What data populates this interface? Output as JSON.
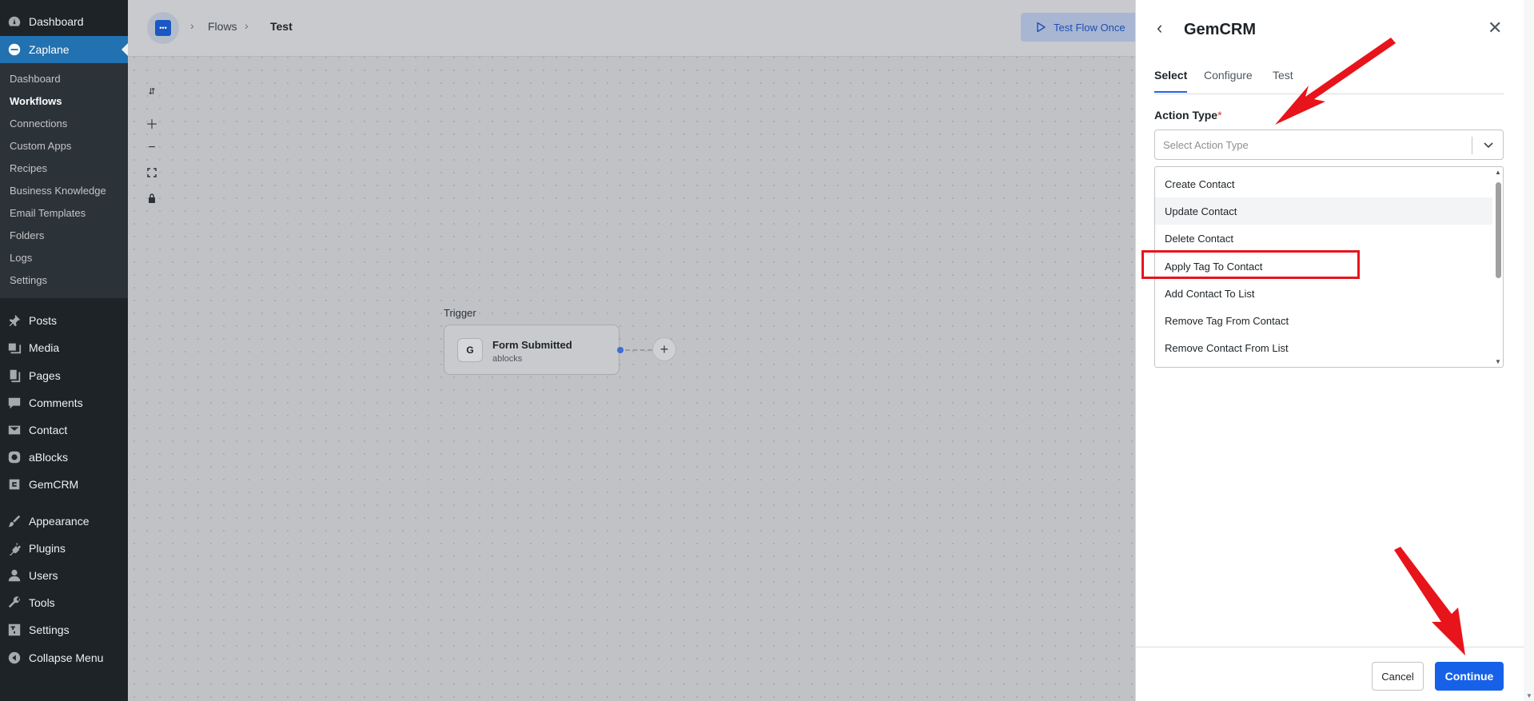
{
  "wp_menu": {
    "top": [
      {
        "label": "Dashboard",
        "icon": "dashboard-icon"
      },
      {
        "label": "Zaplane",
        "icon": "zaplane-icon"
      }
    ],
    "submenu": [
      "Dashboard",
      "Workflows",
      "Connections",
      "Custom Apps",
      "Recipes",
      "Business Knowledge",
      "Email Templates",
      "Folders",
      "Logs",
      "Settings"
    ],
    "bottom": [
      {
        "label": "Posts",
        "icon": "pin-icon"
      },
      {
        "label": "Media",
        "icon": "media-icon"
      },
      {
        "label": "Pages",
        "icon": "pages-icon"
      },
      {
        "label": "Comments",
        "icon": "comments-icon"
      },
      {
        "label": "Contact",
        "icon": "mail-icon"
      },
      {
        "label": "aBlocks",
        "icon": "ablocks-icon"
      },
      {
        "label": "GemCRM",
        "icon": "gemcrm-icon"
      },
      {
        "label": "Appearance",
        "icon": "brush-icon"
      },
      {
        "label": "Plugins",
        "icon": "plug-icon"
      },
      {
        "label": "Users",
        "icon": "user-icon"
      },
      {
        "label": "Tools",
        "icon": "wrench-icon"
      },
      {
        "label": "Settings",
        "icon": "settings-icon"
      },
      {
        "label": "Collapse Menu",
        "icon": "collapse-icon"
      }
    ]
  },
  "breadcrumb": {
    "flows": "Flows",
    "current": "Test"
  },
  "toolbar": {
    "test_flow": "Test Flow Once"
  },
  "canvas": {
    "trigger_label": "Trigger",
    "node_title": "Form Submitted",
    "node_subtitle": "ablocks"
  },
  "panel": {
    "title": "GemCRM",
    "tabs": [
      "Select",
      "Configure",
      "Test"
    ],
    "active_tab": "Select",
    "field_label": "Action Type",
    "required_mark": "*",
    "select_placeholder": "Select Action Type",
    "options": [
      "Create Contact",
      "Update Contact",
      "Delete Contact",
      "Apply Tag To Contact",
      "Add Contact To List",
      "Remove Tag From Contact",
      "Remove Contact From List"
    ],
    "hovered_option": "Update Contact",
    "highlighted_option": "Apply Tag To Contact",
    "cancel_label": "Cancel",
    "continue_label": "Continue"
  },
  "colors": {
    "wp_sidebar": "#1d2327",
    "wp_active": "#2271b1",
    "primary_button": "#1661e8",
    "annotation_red": "#e8141b"
  }
}
